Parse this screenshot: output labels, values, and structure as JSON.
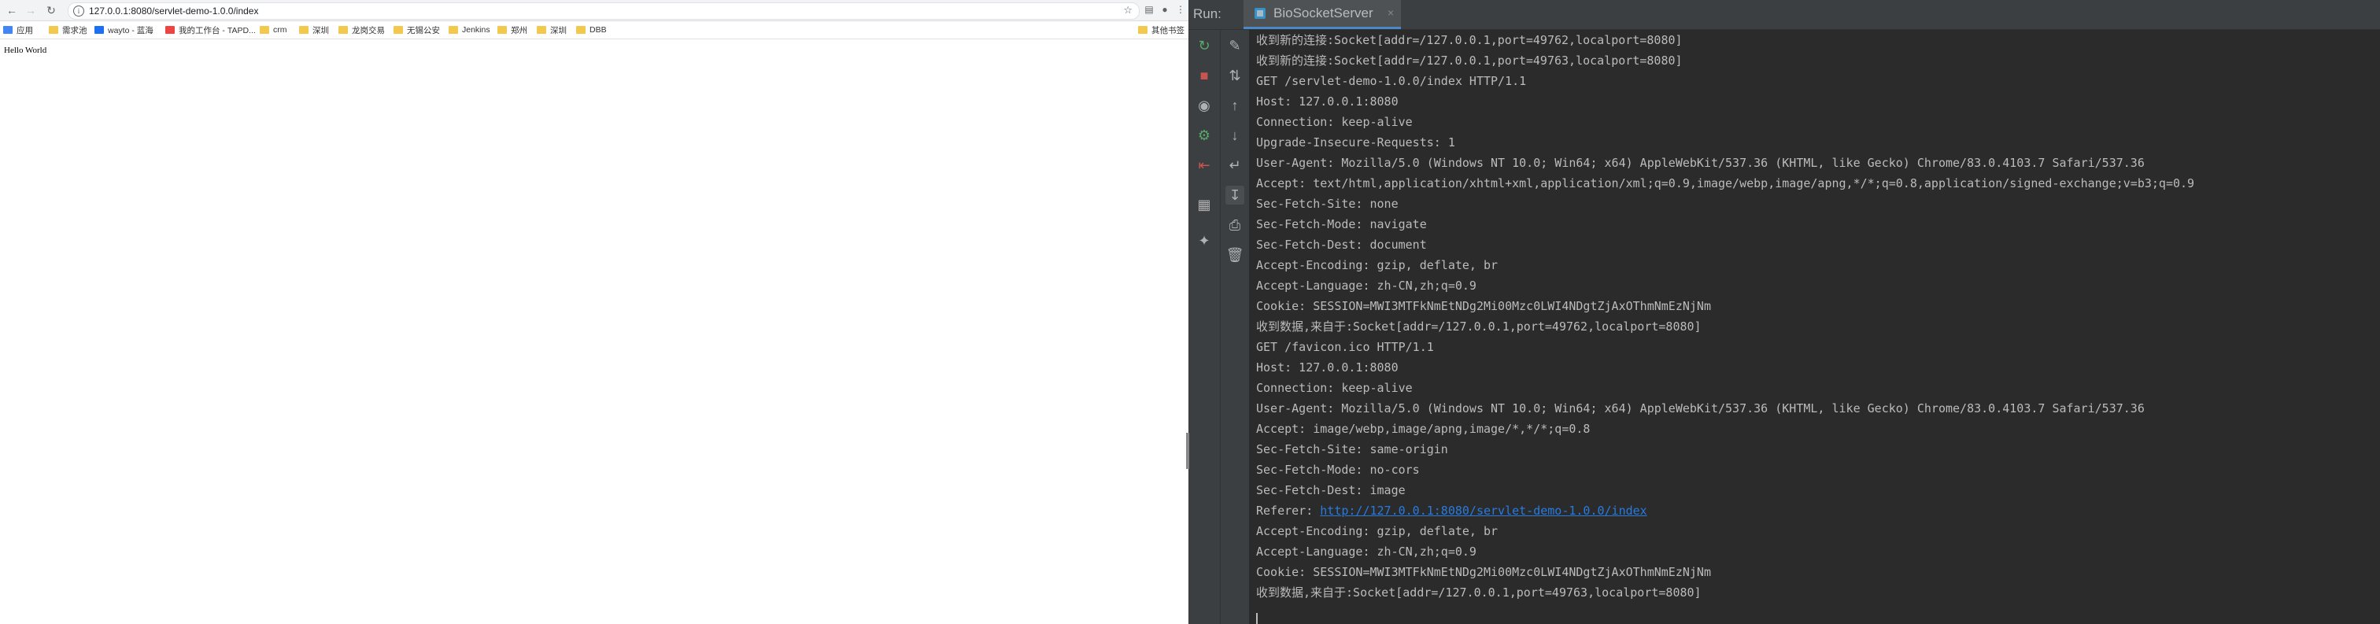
{
  "browser": {
    "nav": {
      "back_icon": "arrow-left-icon",
      "forward_icon": "arrow-right-icon",
      "reload_icon": "reload-icon"
    },
    "url": "127.0.0.1:8080/servlet-demo-1.0.0/index",
    "bookmarks": [
      {
        "label": "应用",
        "icon": "apps-icon"
      },
      {
        "label": "需求池",
        "icon": "folder-icon"
      },
      {
        "label": "wayto - 蓝海",
        "icon": "site-icon"
      },
      {
        "label": "我的工作台 - TAPD...",
        "icon": "site-icon"
      },
      {
        "label": "crm",
        "icon": "folder-icon"
      },
      {
        "label": "深圳",
        "icon": "folder-icon"
      },
      {
        "label": "龙岗交易",
        "icon": "folder-icon"
      },
      {
        "label": "无锡公安",
        "icon": "folder-icon"
      },
      {
        "label": "Jenkins",
        "icon": "folder-icon"
      },
      {
        "label": "郑州",
        "icon": "folder-icon"
      },
      {
        "label": "深圳",
        "icon": "folder-icon"
      },
      {
        "label": "DBB",
        "icon": "folder-icon"
      }
    ],
    "other_bookmarks": "其他书签",
    "page_text": "Hello World"
  },
  "ide": {
    "run_label": "Run:",
    "tab_title": "BioSocketServer",
    "tab_close": "×",
    "console_lines": [
      "收到新的连接:Socket[addr=/127.0.0.1,port=49762,localport=8080]",
      "收到新的连接:Socket[addr=/127.0.0.1,port=49763,localport=8080]",
      "GET /servlet-demo-1.0.0/index HTTP/1.1",
      "Host: 127.0.0.1:8080",
      "Connection: keep-alive",
      "Upgrade-Insecure-Requests: 1",
      "User-Agent: Mozilla/5.0 (Windows NT 10.0; Win64; x64) AppleWebKit/537.36 (KHTML, like Gecko) Chrome/83.0.4103.7 Safari/537.36",
      "Accept: text/html,application/xhtml+xml,application/xml;q=0.9,image/webp,image/apng,*/*;q=0.8,application/signed-exchange;v=b3;q=0.9",
      "Sec-Fetch-Site: none",
      "Sec-Fetch-Mode: navigate",
      "Sec-Fetch-Dest: document",
      "Accept-Encoding: gzip, deflate, br",
      "Accept-Language: zh-CN,zh;q=0.9",
      "Cookie: SESSION=MWI3MTFkNmEtNDg2Mi00Mzc0LWI4NDgtZjAxOThmNmEzNjNm",
      "收到数据,来自于:Socket[addr=/127.0.0.1,port=49762,localport=8080]",
      "GET /favicon.ico HTTP/1.1",
      "Host: 127.0.0.1:8080",
      "Connection: keep-alive",
      "User-Agent: Mozilla/5.0 (Windows NT 10.0; Win64; x64) AppleWebKit/537.36 (KHTML, like Gecko) Chrome/83.0.4103.7 Safari/537.36",
      "Accept: image/webp,image/apng,image/*,*/*;q=0.8",
      "Sec-Fetch-Site: same-origin",
      "Sec-Fetch-Mode: no-cors",
      "Sec-Fetch-Dest: image",
      "Referer: ",
      "Accept-Encoding: gzip, deflate, br",
      "Accept-Language: zh-CN,zh;q=0.9",
      "Cookie: SESSION=MWI3MTFkNmEtNDg2Mi00Mzc0LWI4NDgtZjAxOThmNmEzNjNm",
      "收到数据,来自于:Socket[addr=/127.0.0.1,port=49763,localport=8080]"
    ],
    "referer_link": "http://127.0.0.1:8080/servlet-demo-1.0.0/index",
    "link_color": "#287bde",
    "text_color": "#bbbbbb",
    "background": "#2b2b2b"
  }
}
